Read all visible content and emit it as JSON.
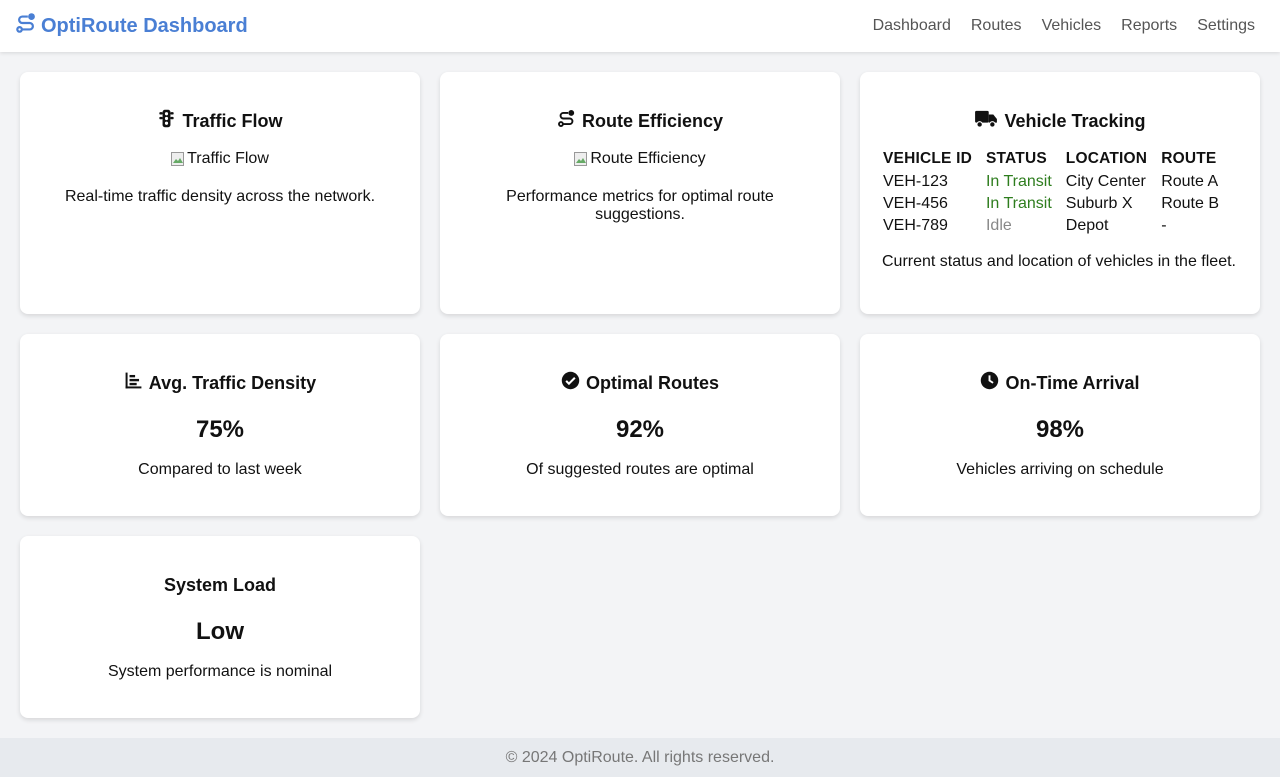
{
  "header": {
    "brand": "OptiRoute Dashboard",
    "brand_icon": "route-icon",
    "brand_color": "#4a7fd4",
    "nav": [
      "Dashboard",
      "Routes",
      "Vehicles",
      "Reports",
      "Settings"
    ]
  },
  "cards": {
    "traffic_flow": {
      "title": "Traffic Flow",
      "icon": "traffic-light-icon",
      "image_alt": "Traffic Flow",
      "description": "Real-time traffic density across the network."
    },
    "route_efficiency": {
      "title": "Route Efficiency",
      "icon": "route-icon",
      "image_alt": "Route Efficiency",
      "description": "Performance metrics for optimal route suggestions."
    },
    "vehicle_tracking": {
      "title": "Vehicle Tracking",
      "icon": "truck-icon",
      "columns": [
        "VEHICLE ID",
        "STATUS",
        "LOCATION",
        "ROUTE"
      ],
      "rows": [
        {
          "id": "VEH-123",
          "status": "In Transit",
          "location": "City Center",
          "route": "Route A"
        },
        {
          "id": "VEH-456",
          "status": "In Transit",
          "location": "Suburb X",
          "route": "Route B"
        },
        {
          "id": "VEH-789",
          "status": "Idle",
          "location": "Depot",
          "route": "-"
        }
      ],
      "description": "Current status and location of vehicles in the fleet.",
      "status_colors": {
        "In Transit": "#2e7d1e",
        "Idle": "#888888"
      }
    },
    "avg_density": {
      "title": "Avg. Traffic Density",
      "icon": "bar-chart-icon",
      "value": "75%",
      "description": "Compared to last week"
    },
    "optimal_routes": {
      "title": "Optimal Routes",
      "icon": "check-circle-icon",
      "value": "92%",
      "description": "Of suggested routes are optimal"
    },
    "on_time": {
      "title": "On-Time Arrival",
      "icon": "clock-icon",
      "value": "98%",
      "description": "Vehicles arriving on schedule"
    },
    "system_load": {
      "title": "System Load",
      "value": "Low",
      "description": "System performance is nominal"
    }
  },
  "footer": {
    "text": "© 2024 OptiRoute. All rights reserved."
  }
}
